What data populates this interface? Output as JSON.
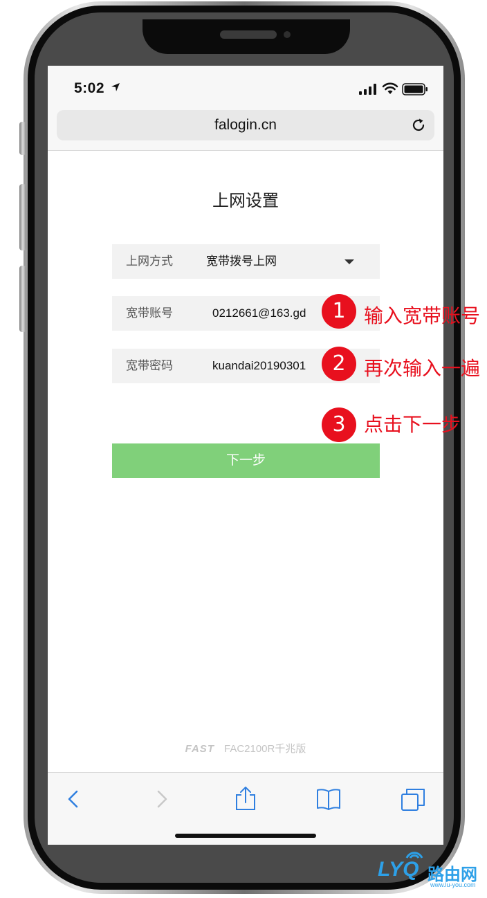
{
  "status_bar": {
    "time": "5:02"
  },
  "browser": {
    "url": "falogin.cn"
  },
  "page": {
    "title": "上网设置",
    "connection_type": {
      "label": "上网方式",
      "value": "宽带拨号上网"
    },
    "account": {
      "label": "宽带账号",
      "value": "0212661@163.gd"
    },
    "password": {
      "label": "宽带密码",
      "value": "kuandai20190301"
    },
    "next_button": "下一步",
    "footer": {
      "brand": "FAST",
      "model": "FAC2100R千兆版"
    }
  },
  "annotations": [
    {
      "number": "1",
      "text": "输入宽带账号"
    },
    {
      "number": "2",
      "text": "再次输入一遍"
    },
    {
      "number": "3",
      "text": "点击下一步"
    }
  ],
  "watermark": {
    "letters": "LYQ",
    "name": "路由网",
    "url": "www.lu-you.com"
  },
  "colors": {
    "button": "#80d07a",
    "annotation_red": "#e8101e",
    "ios_blue": "#2f7fe0",
    "watermark_blue": "#2da0e8"
  }
}
